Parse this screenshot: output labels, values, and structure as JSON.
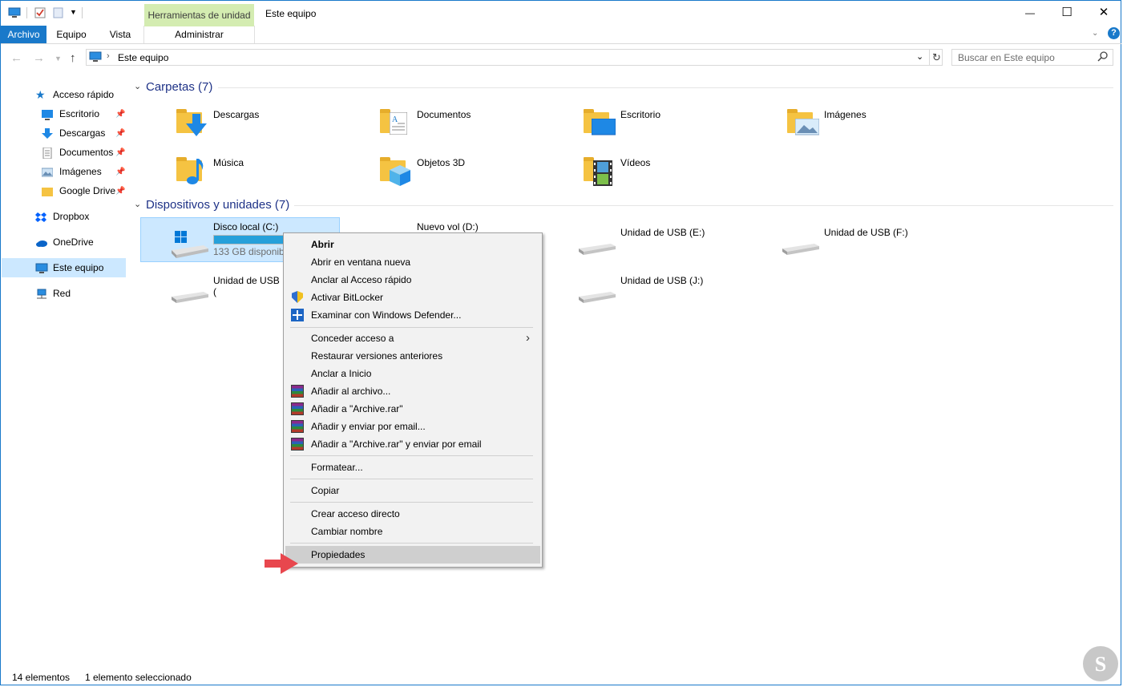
{
  "window": {
    "title": "Este equipo",
    "contextual_tab": "Herramientas de unidad",
    "minimize": "—",
    "maximize": "☐",
    "close": "✕"
  },
  "ribbon": {
    "tabs": [
      "Archivo",
      "Equipo",
      "Vista",
      "Administrar"
    ]
  },
  "address": {
    "path": "Este equipo",
    "search_placeholder": "Buscar en Este equipo"
  },
  "sidebar": {
    "quick_access": "Acceso rápido",
    "items": [
      "Escritorio",
      "Descargas",
      "Documentos",
      "Imágenes",
      "Google Drive"
    ],
    "dropbox": "Dropbox",
    "onedrive": "OneDrive",
    "this_pc": "Este equipo",
    "network": "Red"
  },
  "folders": {
    "header": "Carpetas (7)",
    "items": [
      "Descargas",
      "Documentos",
      "Escritorio",
      "Imágenes",
      "Música",
      "Objetos 3D",
      "Vídeos"
    ]
  },
  "drives": {
    "header": "Dispositivos y unidades (7)",
    "c_name": "Disco local (C:)",
    "c_free": "133 GB disponib",
    "c_used_fraction": 0.55,
    "d_name": "Nuevo vol (D:)",
    "e_name": "Unidad de USB (E:)",
    "f_name": "Unidad de USB (F:)",
    "g_name": "Unidad de USB (",
    "j_name": "Unidad de USB (J:)"
  },
  "context_menu": {
    "open": "Abrir",
    "open_new": "Abrir en ventana nueva",
    "pin_quick": "Anclar al Acceso rápido",
    "bitlocker": "Activar BitLocker",
    "defender": "Examinar con Windows Defender...",
    "grant": "Conceder acceso a",
    "restore": "Restaurar versiones anteriores",
    "pin_start": "Anclar a Inicio",
    "rar_add": "Añadir al archivo...",
    "rar_add_named": "Añadir a \"Archive.rar\"",
    "rar_email": "Añadir y enviar por email...",
    "rar_email_named": "Añadir a \"Archive.rar\" y enviar por email",
    "format": "Formatear...",
    "copy": "Copiar",
    "shortcut": "Crear acceso directo",
    "rename": "Cambiar nombre",
    "properties": "Propiedades"
  },
  "status": {
    "count": "14 elementos",
    "selected": "1 elemento seleccionado"
  },
  "colors": {
    "accent": "#1979ca",
    "selection": "#cce8ff",
    "contextual_tab": "#d4ecb1",
    "folder": "#f5c342",
    "arrow": "#e8474e"
  }
}
